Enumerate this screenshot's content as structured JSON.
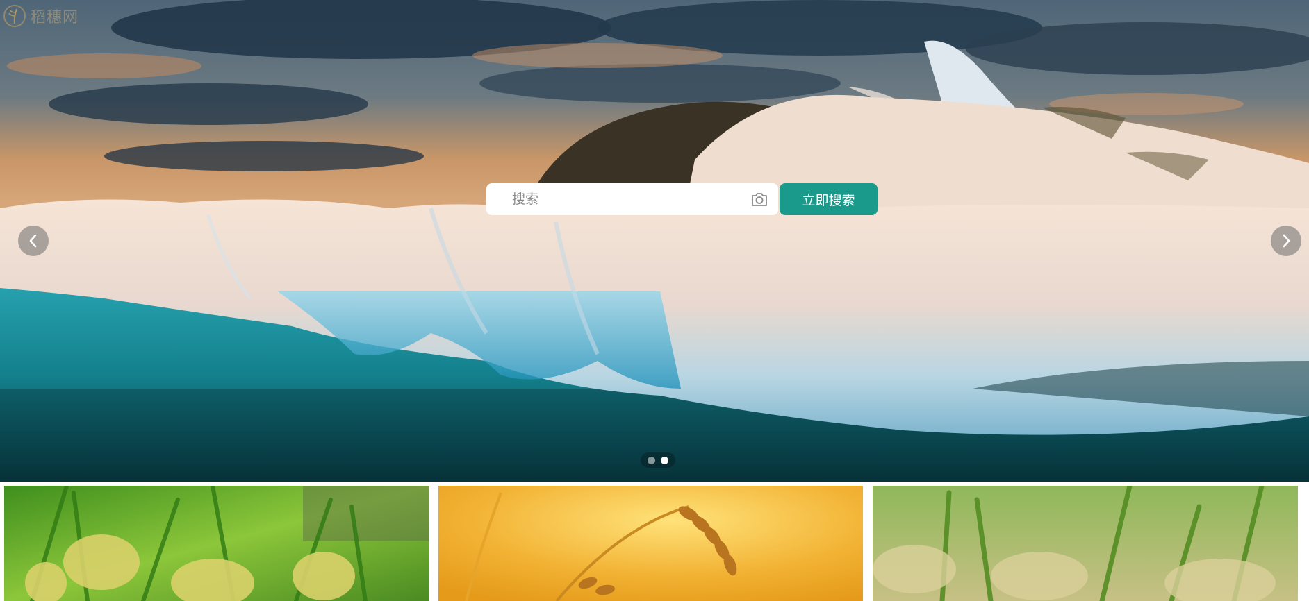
{
  "logo": {
    "text": "稻穗网",
    "icon": "rice-ear-logo"
  },
  "search": {
    "placeholder": "搜索",
    "value": "",
    "button_label": "立即搜索",
    "camera_icon": "camera-icon"
  },
  "carousel": {
    "prev_icon": "chevron-left-icon",
    "next_icon": "chevron-right-icon",
    "slide_count": 2,
    "active_index": 1,
    "image": "iceberg-sunset-photo"
  },
  "tiles": [
    {
      "image": "green-rice-field-photo"
    },
    {
      "image": "golden-wheat-photo"
    },
    {
      "image": "rice-paddy-photo"
    }
  ],
  "colors": {
    "accent": "#1a9a8a",
    "white": "#ffffff"
  }
}
